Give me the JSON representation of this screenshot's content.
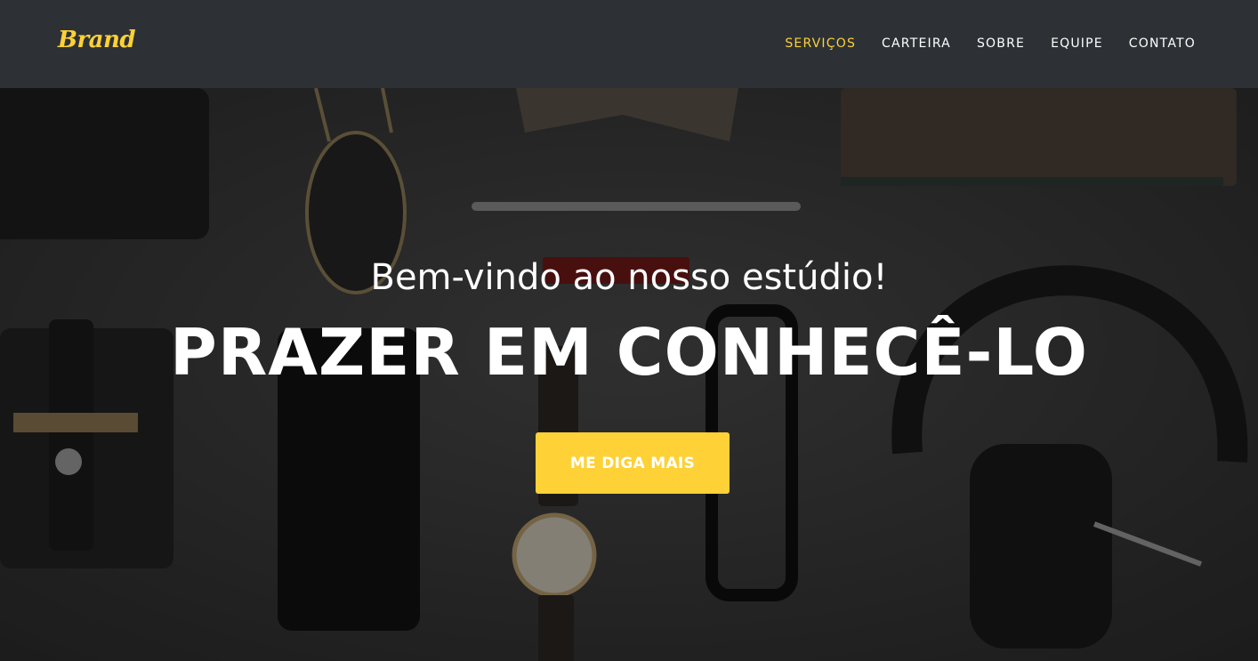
{
  "brand": {
    "name": "Brand"
  },
  "nav": {
    "items": [
      {
        "label": "SERVIÇOS",
        "active": true
      },
      {
        "label": "CARTEIRA",
        "active": false
      },
      {
        "label": "SOBRE",
        "active": false
      },
      {
        "label": "EQUIPE",
        "active": false
      },
      {
        "label": "CONTATO",
        "active": false
      }
    ]
  },
  "hero": {
    "subtitle": "Bem-vindo ao nosso estúdio!",
    "title": "PRAZER EM CONHECÊ-LO",
    "cta_label": "ME DIGA MAIS"
  },
  "colors": {
    "accent": "#fed136",
    "navbar_bg": "#2d3136",
    "text_on_dark": "#ffffff"
  }
}
